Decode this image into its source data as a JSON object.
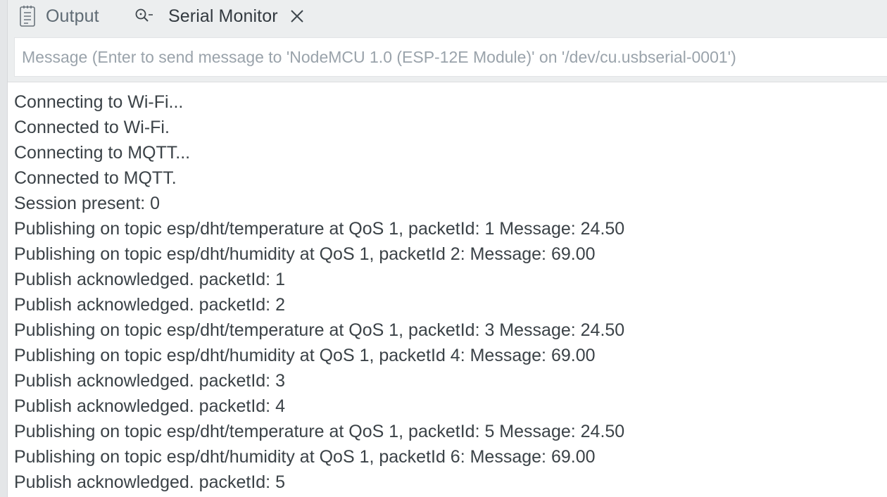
{
  "tabs": {
    "output": {
      "label": "Output"
    },
    "serial_monitor": {
      "label": "Serial Monitor",
      "active": true
    }
  },
  "message_input": {
    "placeholder": "Message (Enter to send message to 'NodeMCU 1.0 (ESP-12E Module)' on '/dev/cu.usbserial-0001')",
    "value": ""
  },
  "log_lines": [
    "Connecting to Wi-Fi...",
    "Connected to Wi-Fi.",
    "Connecting to MQTT...",
    "Connected to MQTT.",
    "Session present: 0",
    "Publishing on topic esp/dht/temperature at QoS 1, packetId: 1 Message: 24.50",
    "Publishing on topic esp/dht/humidity at QoS 1, packetId 2: Message: 69.00",
    "Publish acknowledged.  packetId: 1",
    "Publish acknowledged.  packetId: 2",
    "Publishing on topic esp/dht/temperature at QoS 1, packetId: 3 Message: 24.50",
    "Publishing on topic esp/dht/humidity at QoS 1, packetId 4: Message: 69.00",
    "Publish acknowledged.  packetId: 3",
    "Publish acknowledged.  packetId: 4",
    "Publishing on topic esp/dht/temperature at QoS 1, packetId: 5 Message: 24.50",
    "Publishing on topic esp/dht/humidity at QoS 1, packetId 6: Message: 69.00",
    "Publish acknowledged.  packetId: 5"
  ],
  "icons": {
    "output": "output-log-icon",
    "serial_monitor": "serial-monitor-icon",
    "close": "close-icon"
  }
}
